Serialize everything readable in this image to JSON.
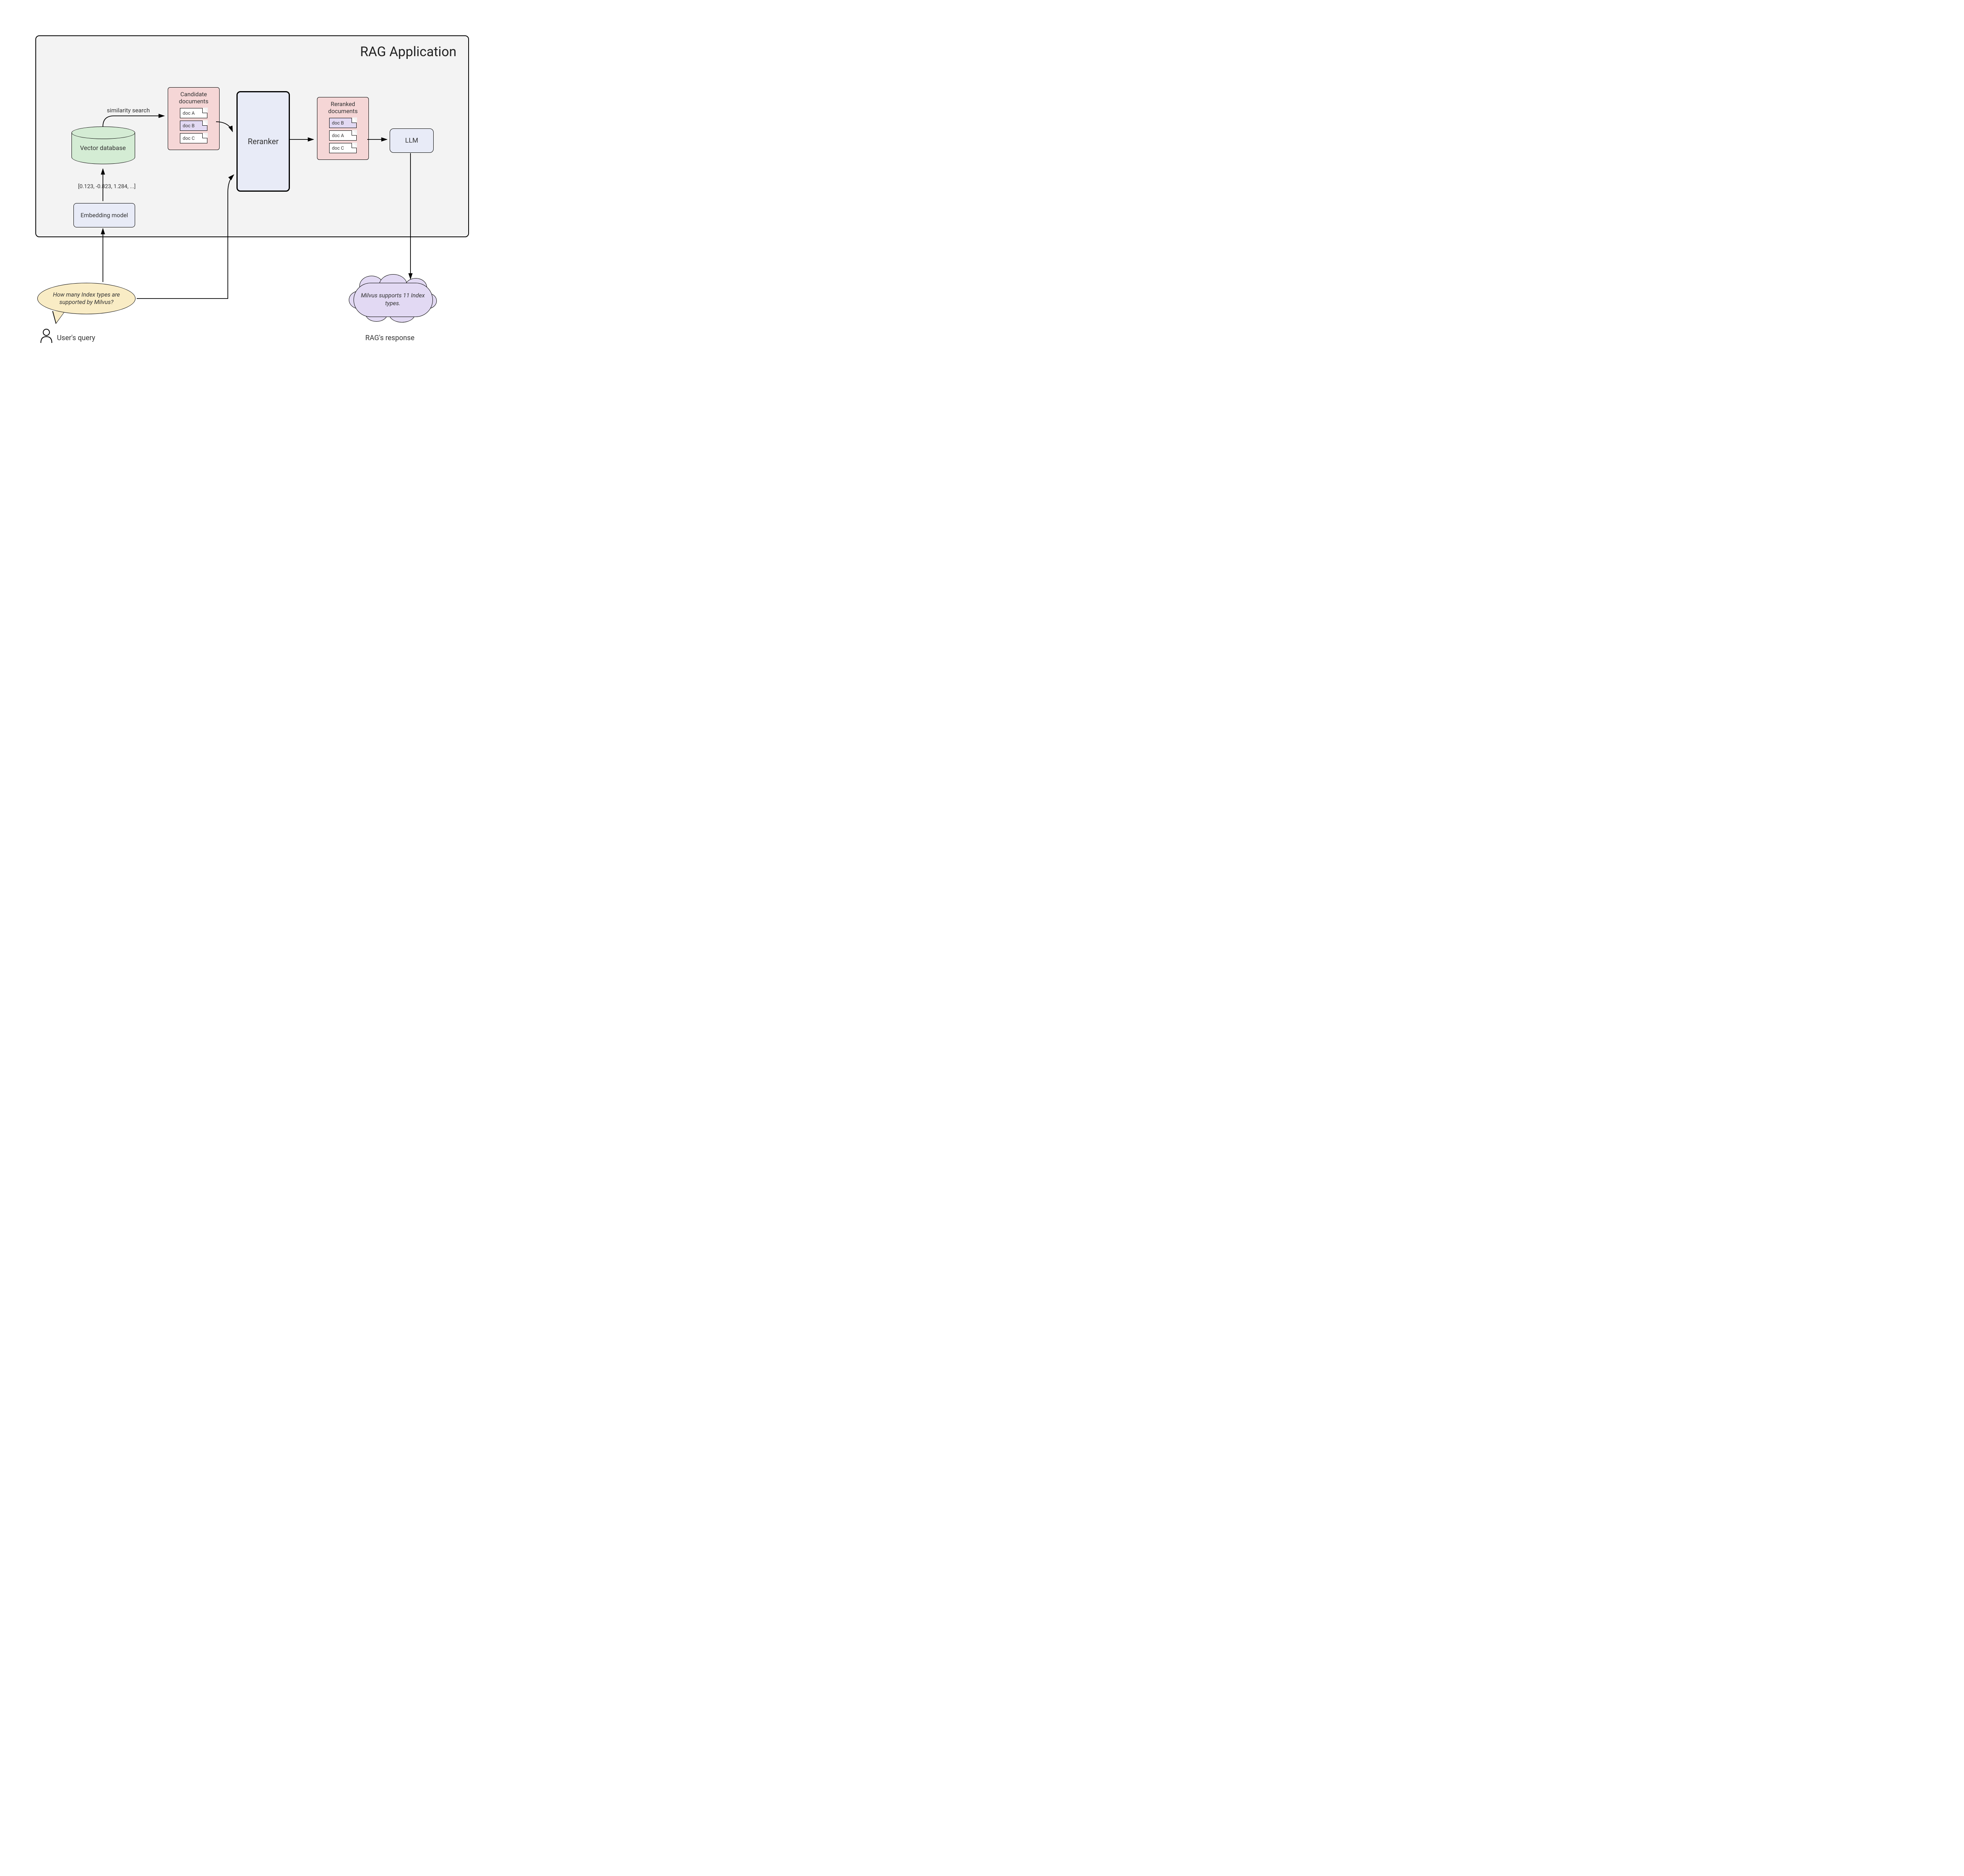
{
  "title": "RAG Application",
  "vector_db": {
    "label": "Vector database"
  },
  "embedding": {
    "label": "Embedding model"
  },
  "vector_sample": "[0.123, -0.823, 1.284, ...]",
  "similarity_label": "similarity search",
  "candidates": {
    "title": "Candidate documents",
    "docs": [
      "doc A",
      "doc B",
      "doc C"
    ]
  },
  "reranker": {
    "label": "Reranker"
  },
  "reranked": {
    "title": "Reranked documents",
    "docs": [
      "doc B",
      "doc A",
      "doc C"
    ]
  },
  "llm": {
    "label": "LLM"
  },
  "user_query": {
    "text": "How many Index types are supported by Milvus?",
    "label": "User's  query"
  },
  "response": {
    "text": "Milvus supports 11 Index types.",
    "label": "RAG's response"
  },
  "colors": {
    "panel_bg": "#f3f3f3",
    "db_fill": "#d4ecd4",
    "box_fill": "#e8ebf7",
    "doc_panel": "#f5d6d6",
    "doc_purple": "#e2d9f3",
    "speech": "#f9ecc5",
    "cloud": "#e2d9f3"
  }
}
